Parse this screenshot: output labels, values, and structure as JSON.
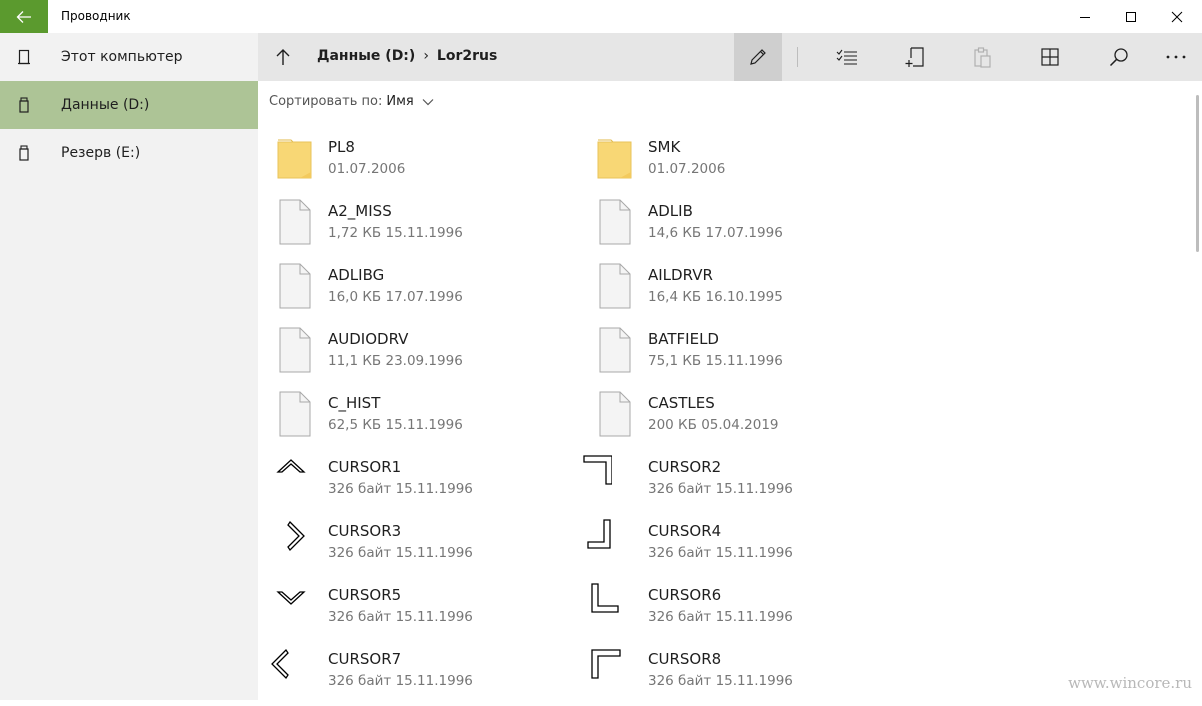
{
  "window": {
    "title": "Проводник"
  },
  "sidebar": {
    "items": [
      {
        "label": "Этот компьютер",
        "icon": "computer-icon",
        "active": false
      },
      {
        "label": "Данные (D:)",
        "icon": "drive-icon",
        "active": true
      },
      {
        "label": "Резерв (E:)",
        "icon": "drive-icon",
        "active": false
      }
    ]
  },
  "breadcrumb": {
    "items": [
      "Данные (D:)",
      "Lor2rus"
    ],
    "separator": "›"
  },
  "toolbar": {
    "tools": [
      "edit-icon",
      "select-list-icon",
      "new-item-icon",
      "paste-icon",
      "grid-view-icon",
      "search-icon",
      "more-icon"
    ]
  },
  "sort": {
    "label": "Сортировать по:",
    "value": "Имя"
  },
  "files": [
    {
      "name": "PL8",
      "meta": "01.07.2006",
      "type": "folder"
    },
    {
      "name": "SMK",
      "meta": "01.07.2006",
      "type": "folder"
    },
    {
      "name": "A2_MISS",
      "meta": "1,72 КБ 15.11.1996",
      "type": "file"
    },
    {
      "name": "ADLIB",
      "meta": "14,6 КБ 17.07.1996",
      "type": "file"
    },
    {
      "name": "ADLIBG",
      "meta": "16,0 КБ 17.07.1996",
      "type": "file"
    },
    {
      "name": "AILDRVR",
      "meta": "16,4 КБ 16.10.1995",
      "type": "file"
    },
    {
      "name": "AUDIODRV",
      "meta": "11,1 КБ 23.09.1996",
      "type": "file"
    },
    {
      "name": "BATFIELD",
      "meta": "75,1 КБ 15.11.1996",
      "type": "file"
    },
    {
      "name": "C_HIST",
      "meta": "62,5 КБ 15.11.1996",
      "type": "file"
    },
    {
      "name": "CASTLES",
      "meta": "200 КБ 05.04.2019",
      "type": "file"
    },
    {
      "name": "CURSOR1",
      "meta": "326 байт 15.11.1996",
      "type": "cursor-up"
    },
    {
      "name": "CURSOR2",
      "meta": "326 байт 15.11.1996",
      "type": "cursor-topright"
    },
    {
      "name": "CURSOR3",
      "meta": "326 байт 15.11.1996",
      "type": "cursor-right"
    },
    {
      "name": "CURSOR4",
      "meta": "326 байт 15.11.1996",
      "type": "cursor-bottomright"
    },
    {
      "name": "CURSOR5",
      "meta": "326 байт 15.11.1996",
      "type": "cursor-down"
    },
    {
      "name": "CURSOR6",
      "meta": "326 байт 15.11.1996",
      "type": "cursor-bottomleft"
    },
    {
      "name": "CURSOR7",
      "meta": "326 байт 15.11.1996",
      "type": "cursor-left"
    },
    {
      "name": "CURSOR8",
      "meta": "326 байт 15.11.1996",
      "type": "cursor-topleft"
    }
  ],
  "watermark": "www.wincore.ru",
  "colors": {
    "accent": "#5b9a2e",
    "active_nav": "#adc496",
    "folder": "#f8d775"
  }
}
